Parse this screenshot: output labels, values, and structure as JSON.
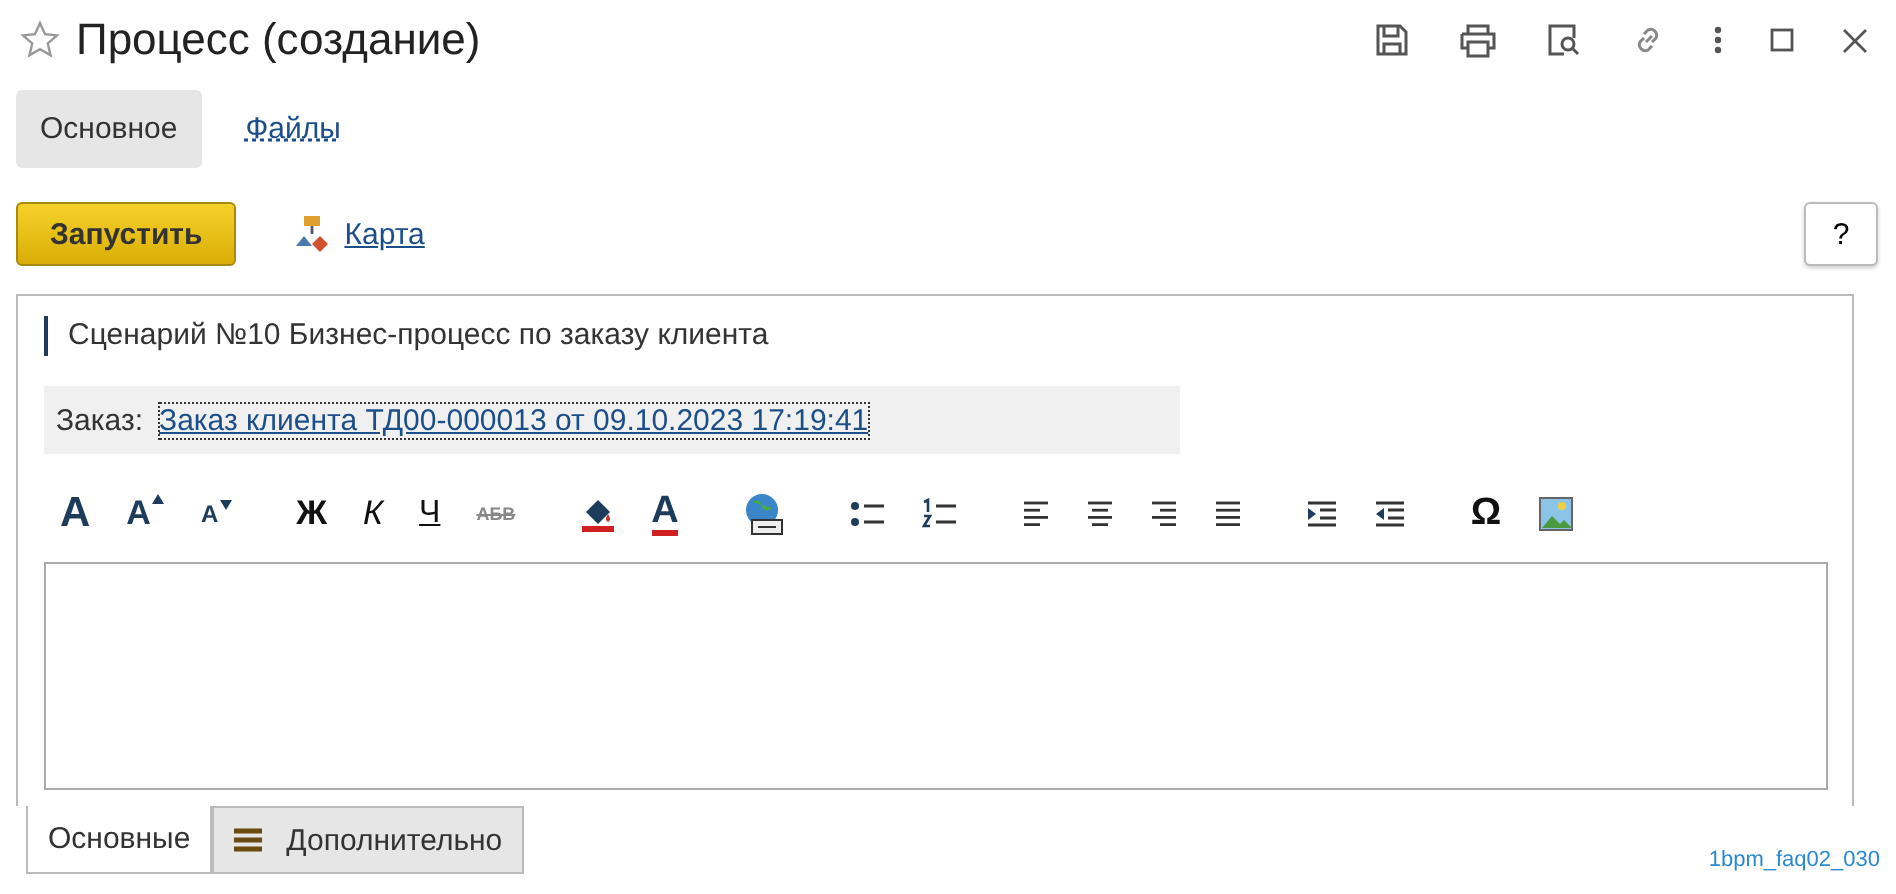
{
  "window": {
    "title": "Процесс (создание)",
    "favorite": false
  },
  "tabs": [
    {
      "label": "Основное",
      "selected": true
    },
    {
      "label": "Файлы",
      "selected": false
    }
  ],
  "command_bar": {
    "start_button": "Запустить",
    "map_link": "Карта",
    "help_button": "?"
  },
  "process": {
    "caption": "Сценарий №10 Бизнес-процесс по заказу клиента",
    "order_label": "Заказ:",
    "order_link": "Заказ клиента ТД00-000013 от 09.10.2023 17:19:41"
  },
  "toolbar": [
    {
      "kind": "font",
      "label": "A"
    },
    {
      "kind": "grow",
      "label": "A"
    },
    {
      "kind": "shrink",
      "label": "A"
    },
    {
      "kind": "bold",
      "label": "Ж"
    },
    {
      "kind": "italic",
      "label": "К"
    },
    {
      "kind": "underline",
      "label": "Ч"
    },
    {
      "kind": "strike",
      "label": "АБВ"
    },
    {
      "kind": "fill"
    },
    {
      "kind": "color",
      "label": "A"
    },
    {
      "kind": "link"
    },
    {
      "kind": "bullets"
    },
    {
      "kind": "numbers"
    },
    {
      "kind": "align-left"
    },
    {
      "kind": "align-center"
    },
    {
      "kind": "align-right"
    },
    {
      "kind": "justify"
    },
    {
      "kind": "indent"
    },
    {
      "kind": "outdent"
    },
    {
      "kind": "symbol",
      "label": "Ω"
    },
    {
      "kind": "image"
    }
  ],
  "bottom_tabs": [
    {
      "label": "Основные",
      "selected": true,
      "menu": false
    },
    {
      "label": "Дополнительно",
      "selected": false,
      "menu": true
    }
  ],
  "figure_code": "1bpm_faq02_030"
}
